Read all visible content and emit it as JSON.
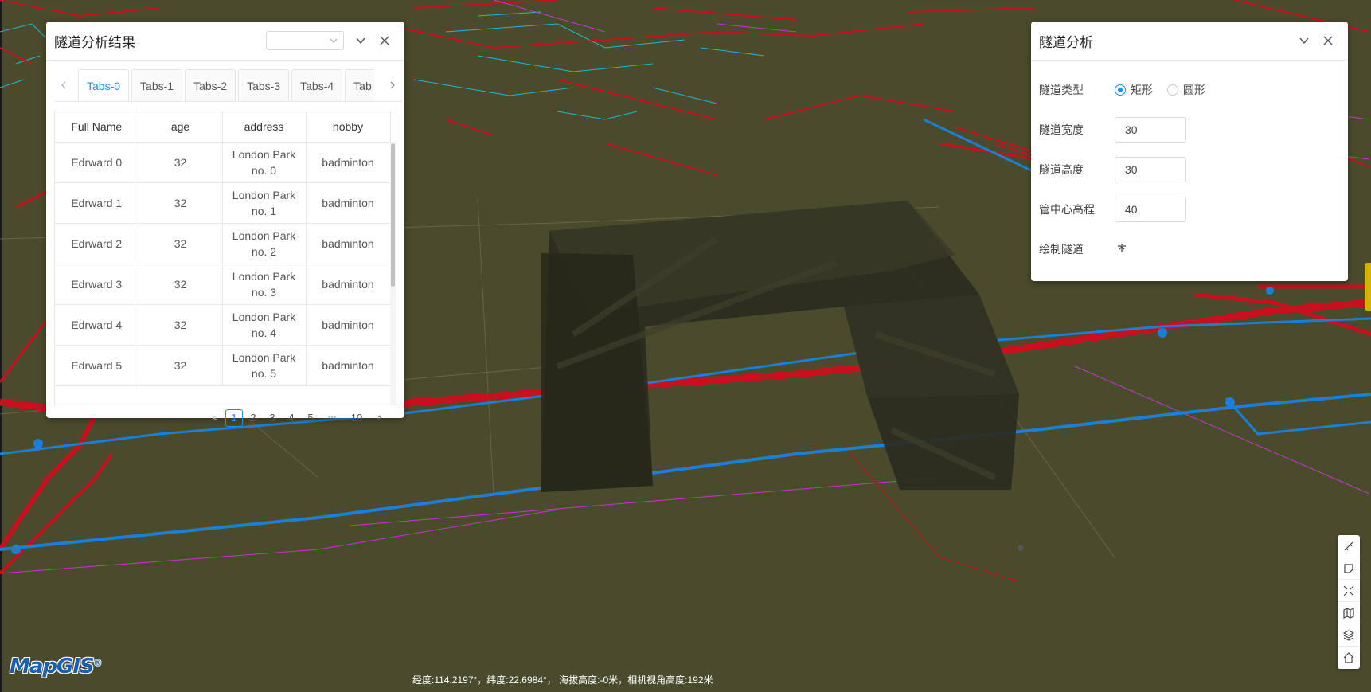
{
  "colors": {
    "ground": "#4a4a2c",
    "pipe_red": "#c8101e",
    "pipe_blue": "#1c7fd6",
    "pipe_cyan": "#22c3d9",
    "pipe_magenta": "#c23bc9",
    "accent": "#1890ff",
    "tunnel": "#2b2b1f"
  },
  "results_panel": {
    "title": "隧道分析结果",
    "select_value": "",
    "collapse_icon": "chevron-down-icon",
    "close_icon": "close-icon",
    "tabs": [
      "Tabs-0",
      "Tabs-1",
      "Tabs-2",
      "Tabs-3",
      "Tabs-4",
      "Tab"
    ],
    "active_tab": 0,
    "columns": [
      "Full Name",
      "age",
      "address",
      "hobby"
    ],
    "rows": [
      {
        "name": "Edrward 0",
        "age": "32",
        "address": "London Park no. 0",
        "hobby": "badminton"
      },
      {
        "name": "Edrward 1",
        "age": "32",
        "address": "London Park no. 1",
        "hobby": "badminton"
      },
      {
        "name": "Edrward 2",
        "age": "32",
        "address": "London Park no. 2",
        "hobby": "badminton"
      },
      {
        "name": "Edrward 3",
        "age": "32",
        "address": "London Park no. 3",
        "hobby": "badminton"
      },
      {
        "name": "Edrward 4",
        "age": "32",
        "address": "London Park no. 4",
        "hobby": "badminton"
      },
      {
        "name": "Edrward 5",
        "age": "32",
        "address": "London Park no. 5",
        "hobby": "badminton"
      }
    ],
    "pagination": {
      "prev": "<",
      "pages": [
        "1",
        "2",
        "3",
        "4",
        "5"
      ],
      "ellipsis": "•••",
      "last": "10",
      "next": ">",
      "current": 1
    }
  },
  "analysis_panel": {
    "title": "隧道分析",
    "type_label": "隧道类型",
    "type_options": [
      "矩形",
      "圆形"
    ],
    "type_selected": "矩形",
    "width_label": "隧道宽度",
    "width_value": "30",
    "height_label": "隧道高度",
    "height_value": "30",
    "elevation_label": "管中心高程",
    "elevation_value": "40",
    "draw_label": "绘制隧道",
    "draw_icon": "draw-tunnel-icon"
  },
  "toolbar": [
    "ruler-icon",
    "polygon-measure-icon",
    "compress-icon",
    "map-icon",
    "layers-icon",
    "home-icon"
  ],
  "status": {
    "text": "经度:114.2197°，纬度:22.6984°， 海拔高度:-0米，相机视角高度:192米"
  },
  "logo": {
    "text": "MapGIS",
    "mark": "®"
  }
}
